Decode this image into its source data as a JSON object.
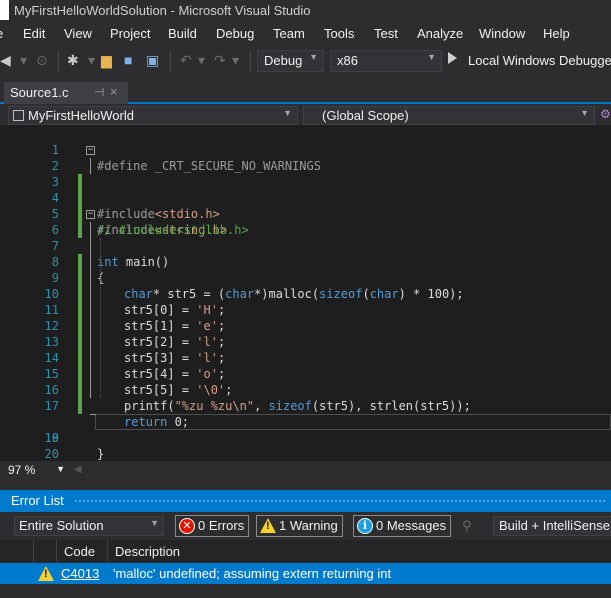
{
  "window": {
    "title": "MyFirstHelloWorldSolution - Microsoft Visual Studio"
  },
  "menu": {
    "items": [
      "e",
      "Edit",
      "View",
      "Project",
      "Build",
      "Debug",
      "Team",
      "Tools",
      "Test",
      "Analyze",
      "Window",
      "Help"
    ]
  },
  "toolbar": {
    "configuration": "Debug",
    "platform": "x86",
    "run_label": "Local Windows Debugger"
  },
  "tab": {
    "label": "Source1.c",
    "pin": "⊣",
    "close": "×"
  },
  "navbar": {
    "project": "MyFirstHelloWorld",
    "scope": "(Global Scope)"
  },
  "editor": {
    "line_numbers": [
      "1",
      "2",
      "3",
      "4",
      "5",
      "6",
      "7",
      "8",
      "9",
      "10",
      "11",
      "12",
      "13",
      "14",
      "15",
      "16",
      "17",
      "18",
      "19",
      "20"
    ],
    "lines": {
      "l1": "#define _CRT_SECURE_NO_WARNINGS",
      "l2_kw": "#include",
      "l2_file": "<stdio.h>",
      "l3_kw": "#include",
      "l3_file": "<string.h>",
      "l4": "// #include<stdlib.h>",
      "l6_kw": "int",
      "l6_rest": " main()",
      "l7": "{",
      "l8_a": "char",
      "l8_b": "* str5 = (",
      "l8_c": "char",
      "l8_d": "*)malloc(",
      "l8_e": "sizeof",
      "l8_f": "(",
      "l8_g": "char",
      "l8_h": ") * 100);",
      "l9_a": "str5[0] = ",
      "l9_b": "'H'",
      "l9_c": ";",
      "l10_a": "str5[1] = ",
      "l10_b": "'e'",
      "l10_c": ";",
      "l11_a": "str5[2] = ",
      "l11_b": "'l'",
      "l11_c": ";",
      "l12_a": "str5[3] = ",
      "l12_b": "'l'",
      "l12_c": ";",
      "l13_a": "str5[4] = ",
      "l13_b": "'o'",
      "l13_c": ";",
      "l14_a": "str5[5] = ",
      "l14_b": "'\\0'",
      "l14_c": ";",
      "l15_a": "printf(",
      "l15_b": "\"%zu %zu\\n\"",
      "l15_c": ", ",
      "l15_d": "sizeof",
      "l15_e": "(str5), strlen(str5));",
      "l17_a": "return",
      "l17_b": " 0;",
      "l18": "}"
    }
  },
  "zoom": {
    "level": "97 %"
  },
  "error_list": {
    "title": "Error List",
    "scope": "Entire Solution",
    "errors_label": "0 Errors",
    "warnings_label": "1 Warning",
    "messages_label": "0 Messages",
    "build_filter": "Build + IntelliSense",
    "columns": {
      "code": "Code",
      "description": "Description"
    },
    "rows": [
      {
        "code": "C4013",
        "description": "'malloc' undefined; assuming extern returning int"
      }
    ]
  },
  "colors": {
    "accent": "#007acc",
    "warning": "#f8d12f",
    "error": "#e51400",
    "info": "#1ba1e2",
    "keyword": "#569cd6",
    "string": "#d69d85",
    "comment": "#57a64a",
    "line_number": "#2b91af"
  }
}
